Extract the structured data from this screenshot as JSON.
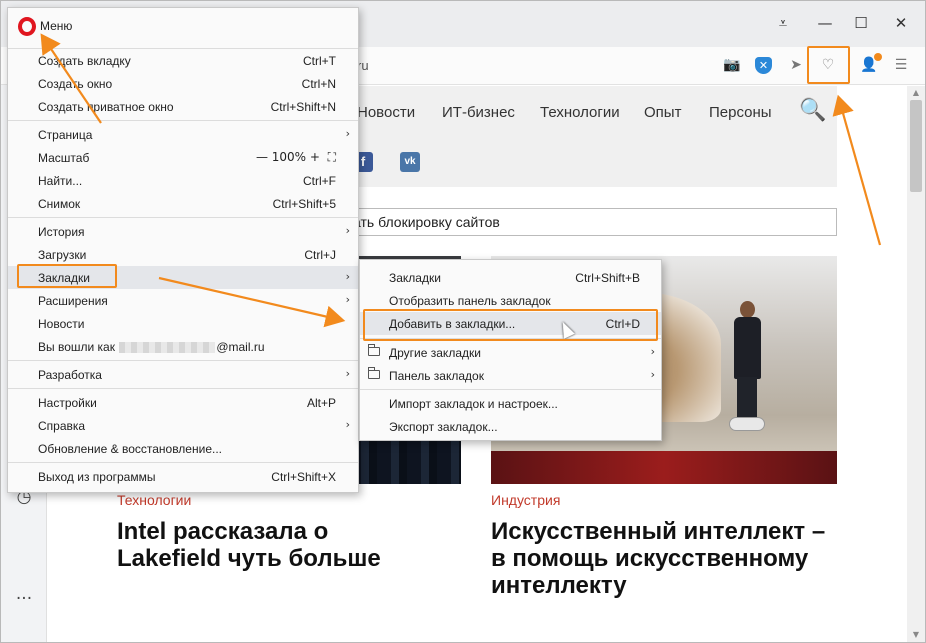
{
  "window": {
    "minimize_glyph": "—",
    "maximize_glyph": "☐",
    "close_glyph": "✕",
    "tabs_glyph": "⩡"
  },
  "address_bar": {
    "url_fragment": "ru",
    "camera_glyph": "📷",
    "send_glyph": "➤",
    "heart_glyph": "♡",
    "user_glyph": "👤",
    "easy_setup_glyph": "☰",
    "shield_glyph": "✕"
  },
  "sidebar": {
    "history_glyph": "◷",
    "more_glyph": "···"
  },
  "page": {
    "nav": [
      "Новости",
      "ИТ-бизнес",
      "Технологии",
      "Опыт",
      "Персоны"
    ],
    "search_glyph": "🔍",
    "social": [
      {
        "label": "f",
        "color": "#3b5998"
      },
      {
        "label": "vk",
        "color": "#4a76a8"
      }
    ],
    "notice_text": "ать блокировку сайтов",
    "articles": [
      {
        "category": "Технологии",
        "headline": "Intel рассказала о Lakefield чуть больше"
      },
      {
        "category": "Индустрия",
        "headline": "Искусственный интеллект – в помощь искусственному интеллекту"
      }
    ]
  },
  "menu": {
    "title": "Меню",
    "items": [
      {
        "label": "Создать вкладку",
        "shortcut": "Ctrl+T"
      },
      {
        "label": "Создать окно",
        "shortcut": "Ctrl+N"
      },
      {
        "label": "Создать приватное окно",
        "shortcut": "Ctrl+Shift+N"
      },
      {
        "label": "Страница",
        "shortcut": "",
        "arrow": "›"
      },
      {
        "label": "Масштаб",
        "zoom": "— 100% +",
        "fullscreen": "⛶"
      },
      {
        "label": "Найти...",
        "shortcut": "Ctrl+F"
      },
      {
        "label": "Снимок",
        "shortcut": "Ctrl+Shift+5"
      },
      {
        "label": "История",
        "shortcut": "",
        "arrow": "›"
      },
      {
        "label": "Загрузки",
        "shortcut": "Ctrl+J"
      },
      {
        "label": "Закладки",
        "shortcut": "",
        "arrow": "›"
      },
      {
        "label": "Расширения",
        "shortcut": "",
        "arrow": "›"
      },
      {
        "label": "Новости",
        "shortcut": ""
      },
      {
        "label_prefix": "Вы вошли как",
        "label_suffix": "@mail.ru"
      },
      {
        "label": "Разработка",
        "shortcut": "",
        "arrow": "›"
      },
      {
        "label": "Настройки",
        "shortcut": "Alt+P"
      },
      {
        "label": "Справка",
        "shortcut": "",
        "arrow": "›"
      },
      {
        "label": "Обновление & восстановление...",
        "shortcut": ""
      },
      {
        "label": "Выход из программы",
        "shortcut": "Ctrl+Shift+X"
      }
    ]
  },
  "submenu": {
    "items": [
      {
        "label": "Закладки",
        "shortcut": "Ctrl+Shift+B"
      },
      {
        "label": "Отобразить панель закладок",
        "shortcut": ""
      },
      {
        "label": "Добавить в закладки...",
        "shortcut": "Ctrl+D"
      },
      {
        "label": "Другие закладки",
        "arrow": "›"
      },
      {
        "label": "Панель закладок",
        "arrow": "›"
      },
      {
        "label": "Импорт закладок и настроек...",
        "shortcut": ""
      },
      {
        "label": "Экспорт закладок...",
        "shortcut": ""
      }
    ]
  },
  "colors": {
    "annotation": "#f28a1d",
    "opera_red": "#e0161f",
    "category_red": "#c23a2b"
  }
}
